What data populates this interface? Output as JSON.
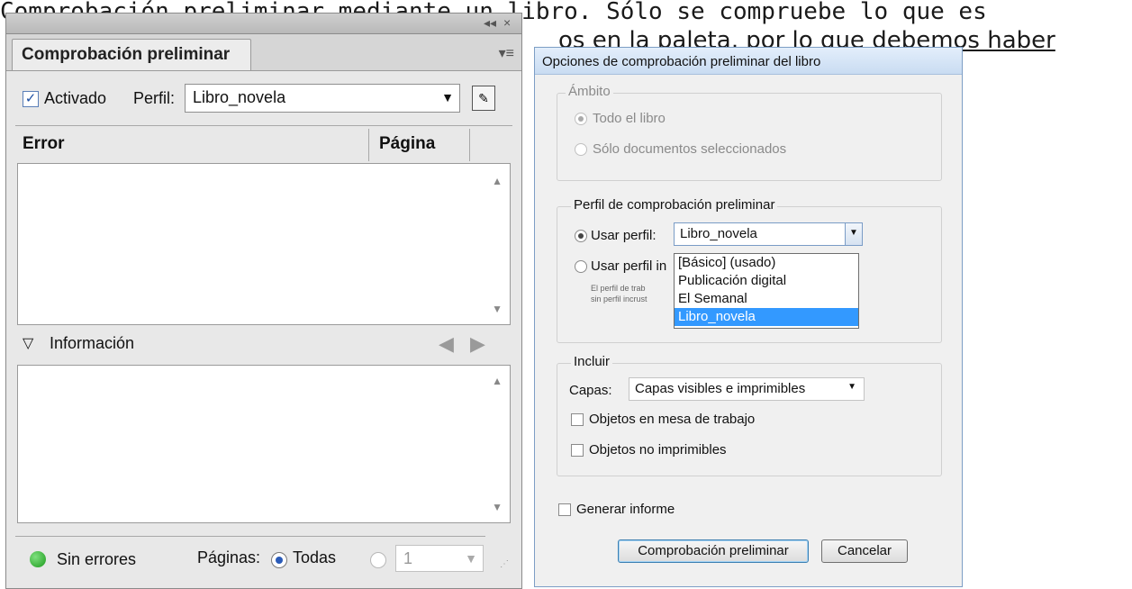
{
  "background": {
    "line1": "Comprobación preliminar mediante un libro. Sólo se compruebe lo que es",
    "line2": "os en la paleta, por lo que debemos haber"
  },
  "panel": {
    "titlebar_buttons": [
      "◂◂",
      "×"
    ],
    "tab_label": "Comprobación preliminar",
    "menu_icon": "panel-menu-icon",
    "activated_label": "Activado",
    "activated_checked": true,
    "profile_label": "Perfil:",
    "profile_value": "Libro_novela",
    "columns": {
      "error": "Error",
      "page": "Página"
    },
    "info_label": "Información",
    "status_text": "Sin errores",
    "pages_label": "Páginas:",
    "pages_all": "Todas",
    "pages_range_value": "1"
  },
  "dialog": {
    "title": "Opciones de comprobación preliminar del libro",
    "scope": {
      "title": "Ámbito",
      "whole_book": "Todo el libro",
      "selected_docs": "Sólo documentos seleccionados"
    },
    "profile_group": {
      "title": "Perfil de comprobación preliminar",
      "use_profile": "Usar perfil:",
      "use_profile_value": "Libro_novela",
      "use_embedded": "Usar perfil in",
      "note_line1": "El perfil de trab",
      "note_line2": "sin perfil incrust",
      "options": [
        "[Básico] (usado)",
        "Publicación digital",
        "El Semanal",
        "Libro_novela"
      ],
      "selected_index": 3
    },
    "include": {
      "title": "Incluir",
      "layers_label": "Capas:",
      "layers_value": "Capas visibles e imprimibles",
      "pasteboard_objects": "Objetos en mesa de trabajo",
      "nonprinting_objects": "Objetos no imprimibles"
    },
    "generate_report": "Generar informe",
    "ok_button": "Comprobación preliminar",
    "cancel_button": "Cancelar"
  },
  "colors": {
    "status_ok": "#2aa02a",
    "selection": "#3399ff",
    "accent": "#1d4fa3"
  }
}
